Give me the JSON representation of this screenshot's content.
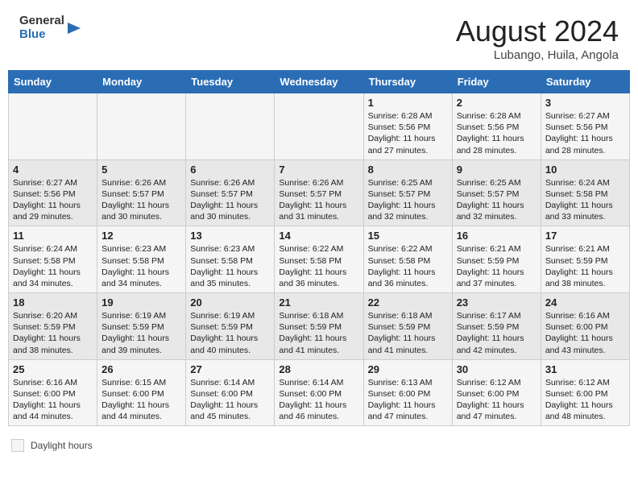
{
  "header": {
    "logo_general": "General",
    "logo_blue": "Blue",
    "title": "August 2024",
    "subtitle": "Lubango, Huila, Angola"
  },
  "days_of_week": [
    "Sunday",
    "Monday",
    "Tuesday",
    "Wednesday",
    "Thursday",
    "Friday",
    "Saturday"
  ],
  "weeks": [
    [
      {
        "num": "",
        "info": ""
      },
      {
        "num": "",
        "info": ""
      },
      {
        "num": "",
        "info": ""
      },
      {
        "num": "",
        "info": ""
      },
      {
        "num": "1",
        "info": "Sunrise: 6:28 AM\nSunset: 5:56 PM\nDaylight: 11 hours and 27 minutes."
      },
      {
        "num": "2",
        "info": "Sunrise: 6:28 AM\nSunset: 5:56 PM\nDaylight: 11 hours and 28 minutes."
      },
      {
        "num": "3",
        "info": "Sunrise: 6:27 AM\nSunset: 5:56 PM\nDaylight: 11 hours and 28 minutes."
      }
    ],
    [
      {
        "num": "4",
        "info": "Sunrise: 6:27 AM\nSunset: 5:56 PM\nDaylight: 11 hours and 29 minutes."
      },
      {
        "num": "5",
        "info": "Sunrise: 6:26 AM\nSunset: 5:57 PM\nDaylight: 11 hours and 30 minutes."
      },
      {
        "num": "6",
        "info": "Sunrise: 6:26 AM\nSunset: 5:57 PM\nDaylight: 11 hours and 30 minutes."
      },
      {
        "num": "7",
        "info": "Sunrise: 6:26 AM\nSunset: 5:57 PM\nDaylight: 11 hours and 31 minutes."
      },
      {
        "num": "8",
        "info": "Sunrise: 6:25 AM\nSunset: 5:57 PM\nDaylight: 11 hours and 32 minutes."
      },
      {
        "num": "9",
        "info": "Sunrise: 6:25 AM\nSunset: 5:57 PM\nDaylight: 11 hours and 32 minutes."
      },
      {
        "num": "10",
        "info": "Sunrise: 6:24 AM\nSunset: 5:58 PM\nDaylight: 11 hours and 33 minutes."
      }
    ],
    [
      {
        "num": "11",
        "info": "Sunrise: 6:24 AM\nSunset: 5:58 PM\nDaylight: 11 hours and 34 minutes."
      },
      {
        "num": "12",
        "info": "Sunrise: 6:23 AM\nSunset: 5:58 PM\nDaylight: 11 hours and 34 minutes."
      },
      {
        "num": "13",
        "info": "Sunrise: 6:23 AM\nSunset: 5:58 PM\nDaylight: 11 hours and 35 minutes."
      },
      {
        "num": "14",
        "info": "Sunrise: 6:22 AM\nSunset: 5:58 PM\nDaylight: 11 hours and 36 minutes."
      },
      {
        "num": "15",
        "info": "Sunrise: 6:22 AM\nSunset: 5:58 PM\nDaylight: 11 hours and 36 minutes."
      },
      {
        "num": "16",
        "info": "Sunrise: 6:21 AM\nSunset: 5:59 PM\nDaylight: 11 hours and 37 minutes."
      },
      {
        "num": "17",
        "info": "Sunrise: 6:21 AM\nSunset: 5:59 PM\nDaylight: 11 hours and 38 minutes."
      }
    ],
    [
      {
        "num": "18",
        "info": "Sunrise: 6:20 AM\nSunset: 5:59 PM\nDaylight: 11 hours and 38 minutes."
      },
      {
        "num": "19",
        "info": "Sunrise: 6:19 AM\nSunset: 5:59 PM\nDaylight: 11 hours and 39 minutes."
      },
      {
        "num": "20",
        "info": "Sunrise: 6:19 AM\nSunset: 5:59 PM\nDaylight: 11 hours and 40 minutes."
      },
      {
        "num": "21",
        "info": "Sunrise: 6:18 AM\nSunset: 5:59 PM\nDaylight: 11 hours and 41 minutes."
      },
      {
        "num": "22",
        "info": "Sunrise: 6:18 AM\nSunset: 5:59 PM\nDaylight: 11 hours and 41 minutes."
      },
      {
        "num": "23",
        "info": "Sunrise: 6:17 AM\nSunset: 5:59 PM\nDaylight: 11 hours and 42 minutes."
      },
      {
        "num": "24",
        "info": "Sunrise: 6:16 AM\nSunset: 6:00 PM\nDaylight: 11 hours and 43 minutes."
      }
    ],
    [
      {
        "num": "25",
        "info": "Sunrise: 6:16 AM\nSunset: 6:00 PM\nDaylight: 11 hours and 44 minutes."
      },
      {
        "num": "26",
        "info": "Sunrise: 6:15 AM\nSunset: 6:00 PM\nDaylight: 11 hours and 44 minutes."
      },
      {
        "num": "27",
        "info": "Sunrise: 6:14 AM\nSunset: 6:00 PM\nDaylight: 11 hours and 45 minutes."
      },
      {
        "num": "28",
        "info": "Sunrise: 6:14 AM\nSunset: 6:00 PM\nDaylight: 11 hours and 46 minutes."
      },
      {
        "num": "29",
        "info": "Sunrise: 6:13 AM\nSunset: 6:00 PM\nDaylight: 11 hours and 47 minutes."
      },
      {
        "num": "30",
        "info": "Sunrise: 6:12 AM\nSunset: 6:00 PM\nDaylight: 11 hours and 47 minutes."
      },
      {
        "num": "31",
        "info": "Sunrise: 6:12 AM\nSunset: 6:00 PM\nDaylight: 11 hours and 48 minutes."
      }
    ]
  ],
  "legend": {
    "label": "Daylight hours"
  }
}
